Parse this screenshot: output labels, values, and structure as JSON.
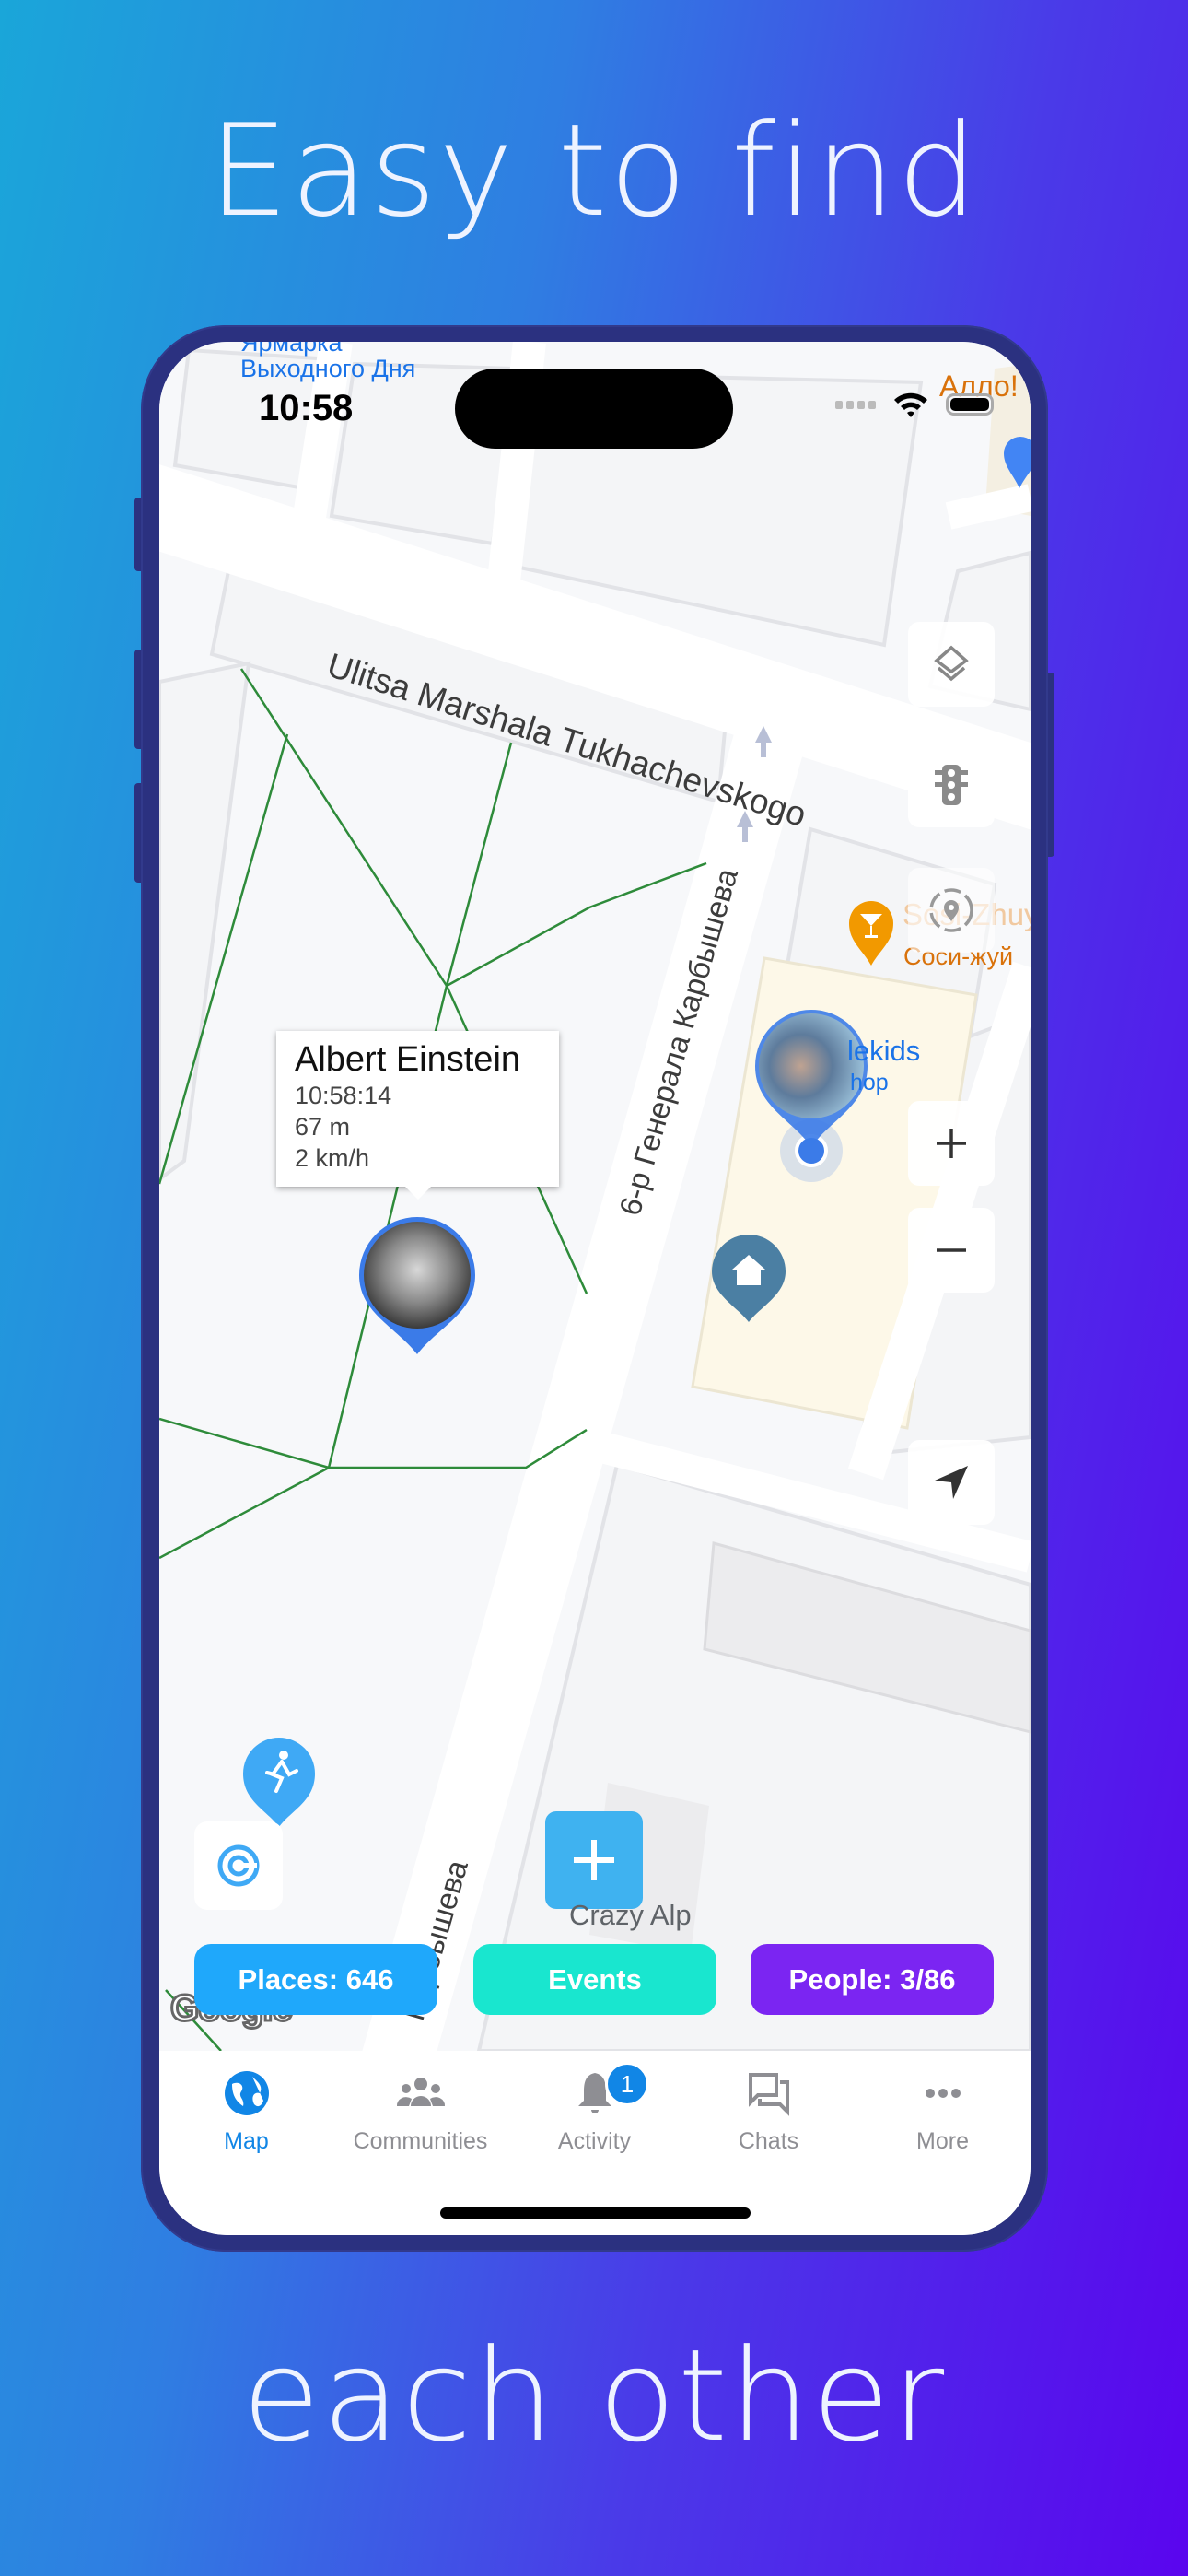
{
  "promo": {
    "top_text": "Easy to find",
    "bottom_text": "each other"
  },
  "status_bar": {
    "time": "10:58"
  },
  "map": {
    "street_labels": {
      "main_street": "Ulitsa Marshala Tukhachevskogo",
      "side_street": "6-р Генерала Карбышева",
      "side_street_bottom": "Карбышева",
      "top_poi_line1": "Ярмарка",
      "top_poi_line2": "Выходного Дня"
    },
    "pois": [
      {
        "label": "Алло!",
        "color": "#d9720b"
      },
      {
        "label": "Sosi-Zhuy",
        "sublabel": "Соси-жуй",
        "icon": "cocktail-icon",
        "color": "#f29900"
      },
      {
        "label": "lekids",
        "sublabel": "hop",
        "color": "#1a73e8"
      },
      {
        "label": "Crazy Alp",
        "color": "#5f6368"
      }
    ],
    "attribution": "Google",
    "colors": {
      "park_path": "#2e8b3a",
      "road": "#ffffff",
      "user_pin": "#3b7be8",
      "home_pin": "#4b7fa3"
    }
  },
  "callout": {
    "name": "Albert Einstein",
    "time": "10:58:14",
    "distance": "67 m",
    "speed": "2 km/h"
  },
  "controls": [
    "layers-icon",
    "traffic-light-icon",
    "location-target-icon",
    "zoom-in-icon",
    "zoom-out-icon",
    "navigate-arrow-icon"
  ],
  "filters": [
    {
      "label": "Places: 646",
      "color": "#1fa8fb"
    },
    {
      "label": "Events",
      "color": "#19e6cf"
    },
    {
      "label": "People: 3/86",
      "color": "#7b25f2"
    }
  ],
  "tabs": [
    {
      "label": "Map",
      "icon": "globe-icon",
      "active": true
    },
    {
      "label": "Communities",
      "icon": "group-icon"
    },
    {
      "label": "Activity",
      "icon": "bell-icon",
      "badge": "1"
    },
    {
      "label": "Chats",
      "icon": "chat-bubbles-icon"
    },
    {
      "label": "More",
      "icon": "more-dots-icon"
    }
  ],
  "accent_color": "#1186e6"
}
